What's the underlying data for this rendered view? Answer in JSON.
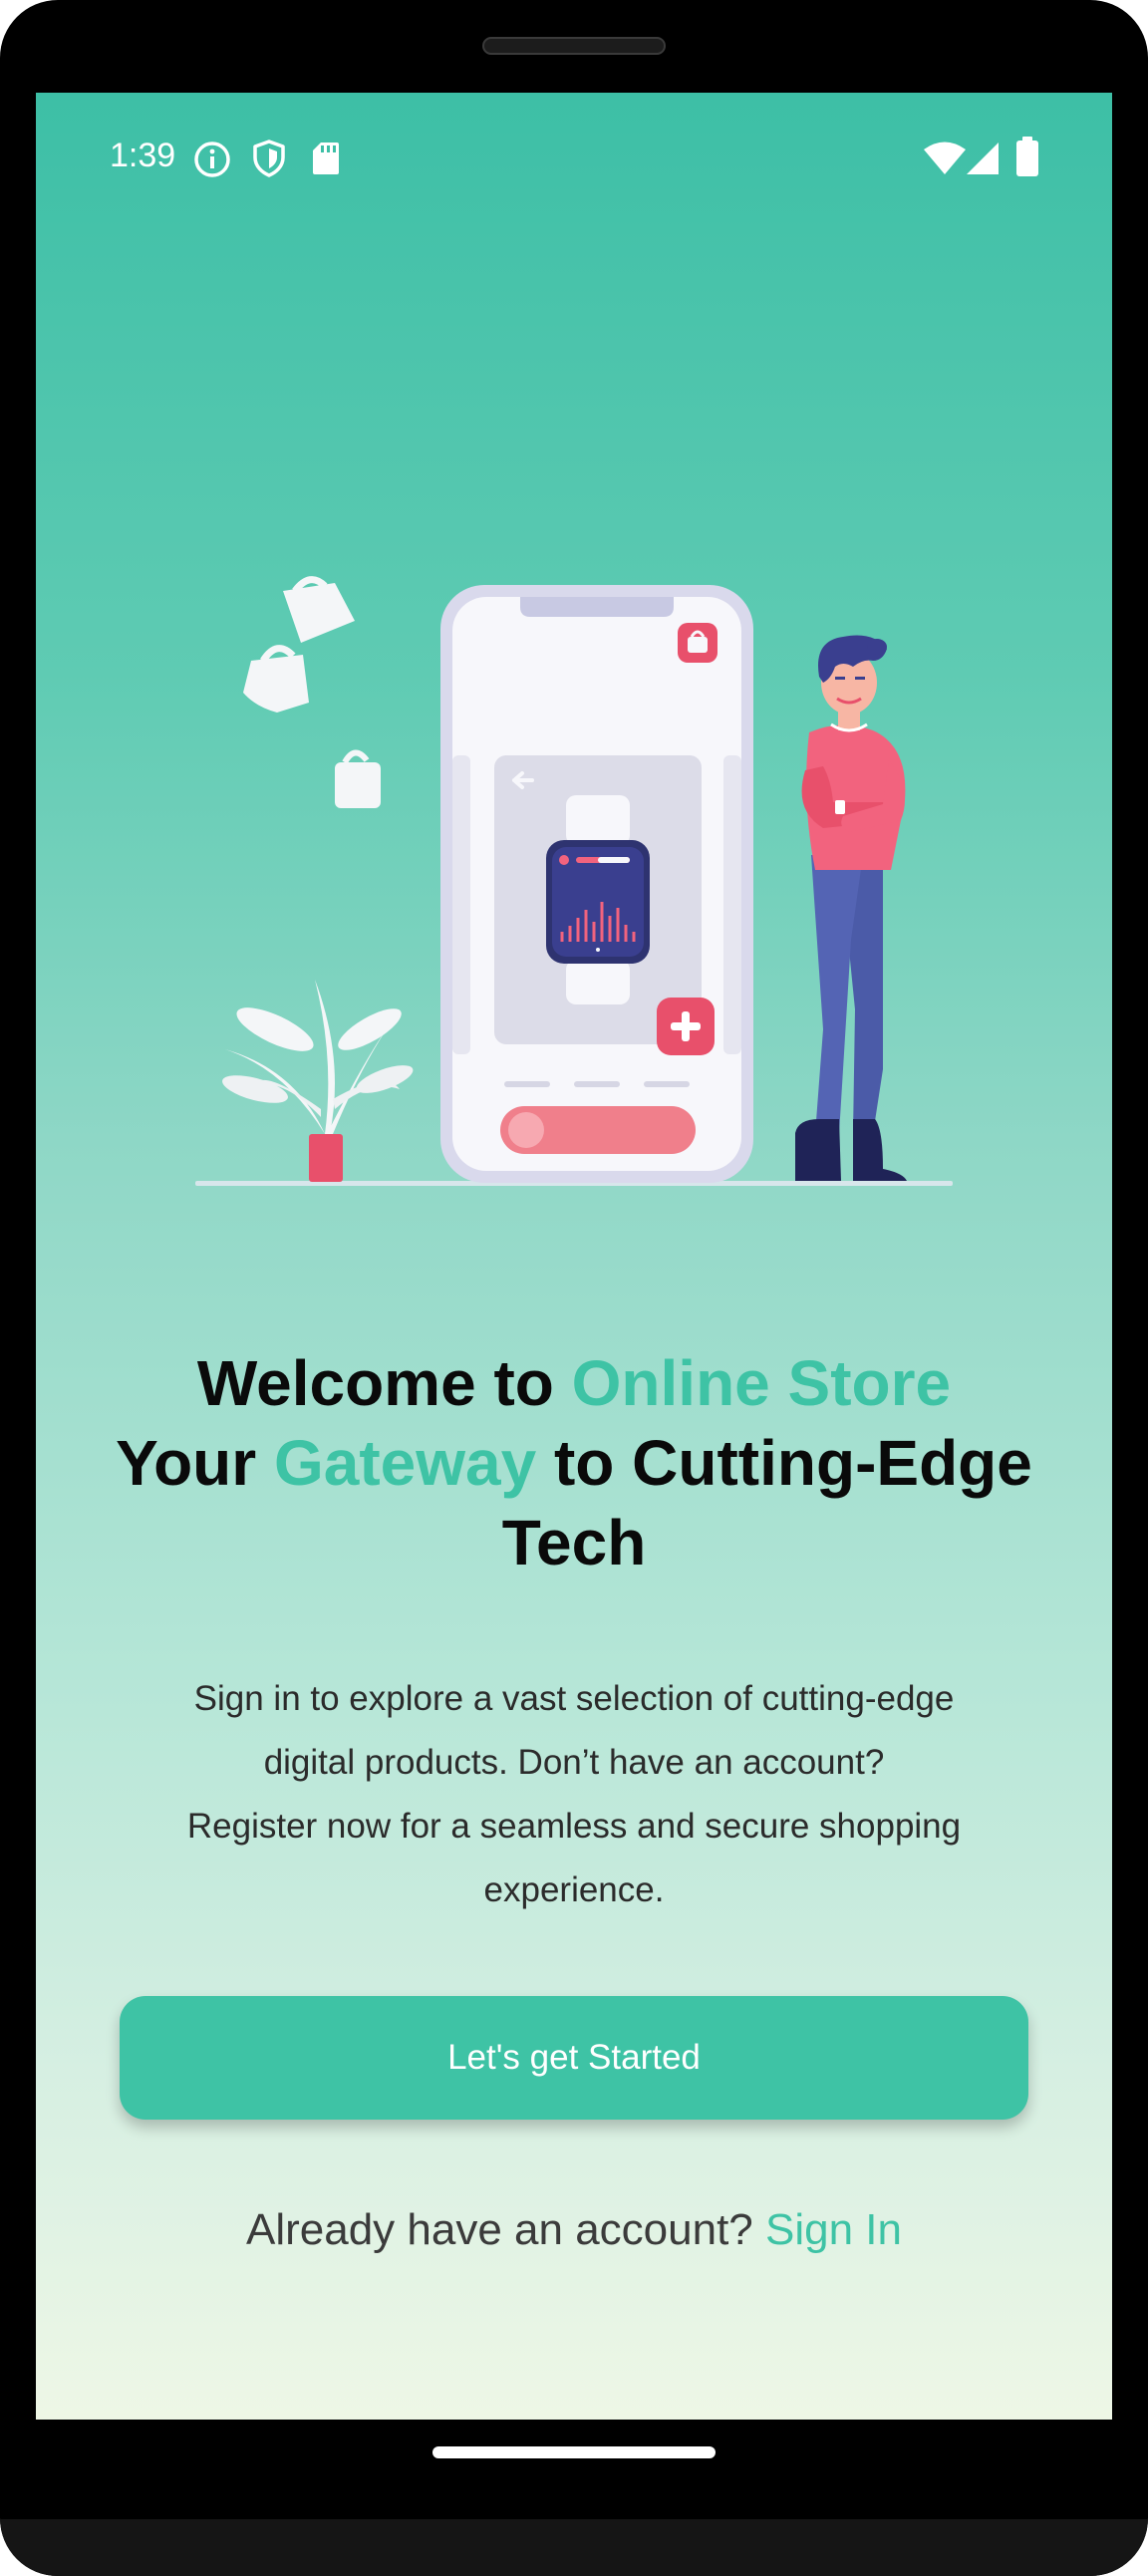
{
  "status_bar": {
    "time": "1:39",
    "left_icons": [
      "info-icon",
      "shield-icon",
      "sd-card-icon"
    ],
    "right_icons": [
      "wifi-icon",
      "signal-icon",
      "battery-icon"
    ]
  },
  "illustration": {
    "description_icons": [
      "shopping-bag-icon",
      "smartwatch-icon",
      "plus-icon",
      "person-icon",
      "plant-icon"
    ]
  },
  "headline": {
    "line1_prefix": "Welcome to ",
    "line1_accent": "Online Store",
    "line2_prefix": "Your ",
    "line2_accent": "Gateway",
    "line2_suffix": " to Cutting-Edge",
    "line3": "Tech"
  },
  "description": {
    "line1": "Sign in to explore a vast selection of cutting-edge",
    "line2": "digital products. Don’t have an account?",
    "line3": "Register now for a seamless and secure shopping",
    "line4": "experience."
  },
  "cta": {
    "label": "Let's get Started"
  },
  "signin": {
    "prompt": "Already have an account? ",
    "link": "Sign In"
  },
  "colors": {
    "accent": "#3ec3a5",
    "gradient_top": "#3dbfa6",
    "gradient_bottom": "#eef7e6",
    "headline_text": "#0a0a0a",
    "body_text": "#2b2b2b",
    "illustration_pink": "#f2637e",
    "illustration_navy": "#3a3f8f"
  }
}
